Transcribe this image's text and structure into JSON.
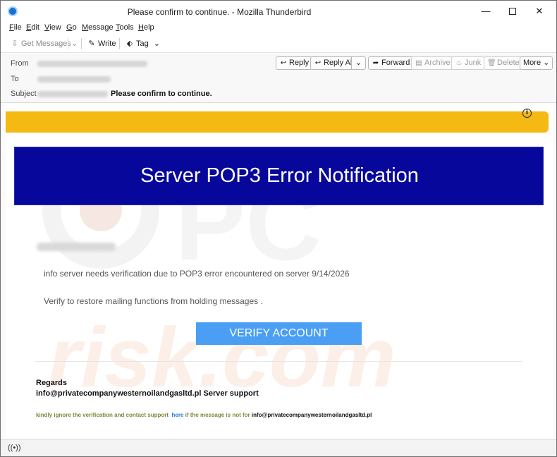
{
  "window": {
    "title": "Please confirm to continue. - Mozilla Thunderbird",
    "minimize": "—",
    "close": "✕"
  },
  "menu": [
    "File",
    "Edit",
    "View",
    "Go",
    "Message",
    "Tools",
    "Help"
  ],
  "toolbar": {
    "get_messages": "Get Messages",
    "write": "Write",
    "tag": "Tag"
  },
  "header": {
    "from_label": "From",
    "to_label": "To",
    "subject_label": "Subject",
    "subject": "Please confirm to continue.",
    "buttons": {
      "reply": "Reply",
      "reply_all": "Reply All",
      "forward": "Forward",
      "archive": "Archive",
      "junk": "Junk",
      "delete": "Delete",
      "more": "More"
    }
  },
  "email": {
    "info_icon": "i",
    "banner_title": "Server POP3 Error Notification",
    "line1": "info server needs verification due to POP3 error encountered on server 9/14/2026",
    "line2": "Verify to restore mailing functions from holding messages .",
    "verify_button": "VERIFY ACCOUNT",
    "regards": "Regards",
    "signature": "info@privatecompanywesternoilandgasltd.pl Server support",
    "footer_part1": "kindly ignore the verification and  contact support",
    "footer_link": "here",
    "footer_part2": "if the message is not for",
    "footer_email": "info@privatecompanywesternoilandgasltd.pl"
  },
  "watermark": {
    "text": "risk.com"
  },
  "colors": {
    "banner": "#07089b",
    "alert_bar": "#f4b912",
    "verify_button": "#4a9ff5"
  }
}
